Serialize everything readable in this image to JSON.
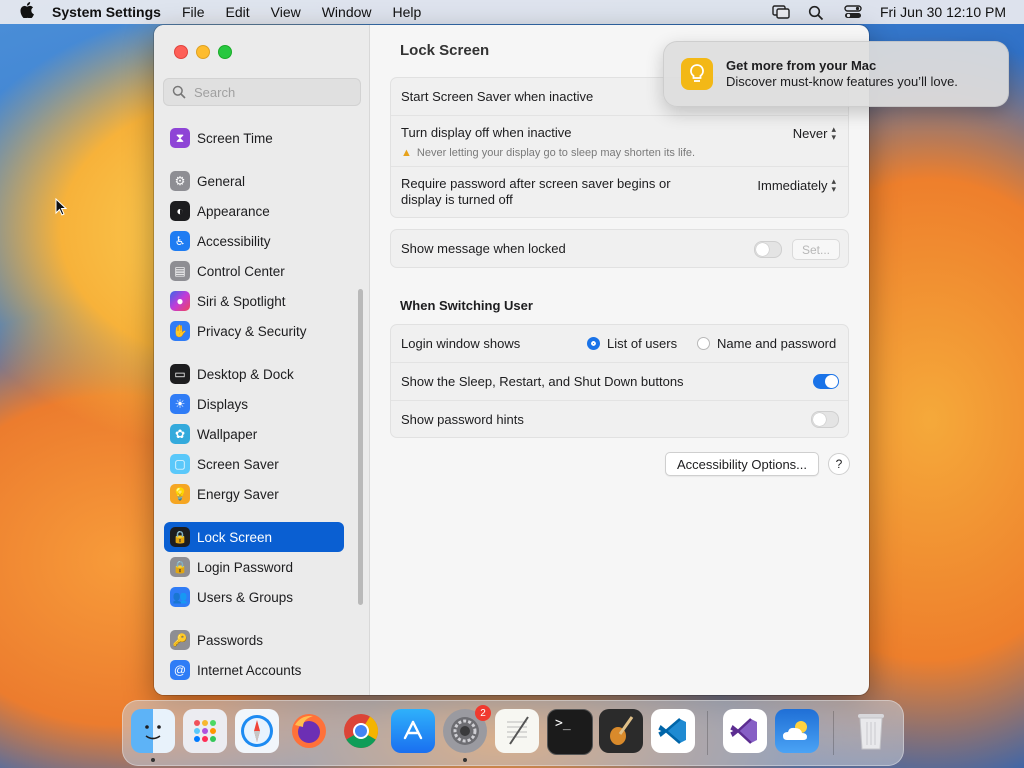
{
  "menubar": {
    "app_name": "System Settings",
    "menus": [
      "File",
      "Edit",
      "View",
      "Window",
      "Help"
    ],
    "clock": "Fri Jun 30  12:10 PM"
  },
  "sidebar": {
    "search_placeholder": "Search",
    "items": [
      {
        "label": "Screen Time",
        "icon": "hourglass-icon",
        "color": "#8e44d6"
      },
      {
        "label": "General",
        "icon": "gear-icon",
        "color": "#8e8e93"
      },
      {
        "label": "Appearance",
        "icon": "appearance-icon",
        "color": "#1d1d1f"
      },
      {
        "label": "Accessibility",
        "icon": "accessibility-icon",
        "color": "#1e7cf2"
      },
      {
        "label": "Control Center",
        "icon": "control-center-icon",
        "color": "#8e8e93"
      },
      {
        "label": "Siri & Spotlight",
        "icon": "siri-icon",
        "color": "#c23bd9"
      },
      {
        "label": "Privacy & Security",
        "icon": "hand-icon",
        "color": "#2f7cf6"
      },
      {
        "label": "Desktop & Dock",
        "icon": "dock-icon",
        "color": "#1d1d1f"
      },
      {
        "label": "Displays",
        "icon": "sun-icon",
        "color": "#2f7cf6"
      },
      {
        "label": "Wallpaper",
        "icon": "flower-icon",
        "color": "#34aadc"
      },
      {
        "label": "Screen Saver",
        "icon": "screen-saver-icon",
        "color": "#5ac8fa"
      },
      {
        "label": "Energy Saver",
        "icon": "lightbulb-icon",
        "color": "#f5a623"
      },
      {
        "label": "Lock Screen",
        "icon": "lock-icon",
        "color": "#1d1d1f"
      },
      {
        "label": "Login Password",
        "icon": "lock-icon",
        "color": "#8e8e93"
      },
      {
        "label": "Users & Groups",
        "icon": "users-icon",
        "color": "#2f7cf6"
      },
      {
        "label": "Passwords",
        "icon": "key-icon",
        "color": "#8e8e93"
      },
      {
        "label": "Internet Accounts",
        "icon": "at-icon",
        "color": "#2f7cf6"
      }
    ],
    "selected": "Lock Screen"
  },
  "content": {
    "title": "Lock Screen",
    "screensaver_label": "Start Screen Saver when inactive",
    "display_off_label": "Turn display off when inactive",
    "display_off_value": "Never",
    "display_off_warning": "Never letting your display go to sleep may shorten its life.",
    "require_password_label": "Require password after screen saver begins or display is turned off",
    "require_password_value": "Immediately",
    "show_message_label": "Show message when locked",
    "show_message_on": false,
    "set_button": "Set...",
    "switching_title": "When Switching User",
    "login_window_label": "Login window shows",
    "login_options": [
      "List of users",
      "Name and password"
    ],
    "login_selected": "List of users",
    "sleep_buttons_label": "Show the Sleep, Restart, and Shut Down buttons",
    "sleep_buttons_on": true,
    "password_hints_label": "Show password hints",
    "password_hints_on": false,
    "accessibility_button": "Accessibility Options...",
    "help_button": "?"
  },
  "notification": {
    "title": "Get more from your Mac",
    "body": "Discover must-know features you’ll love."
  },
  "dock": {
    "apps": [
      {
        "name": "finder-icon",
        "color": "#3c9bf2"
      },
      {
        "name": "launchpad-icon",
        "color": "#e8e8ee"
      },
      {
        "name": "safari-icon",
        "color": "#e9f2fb"
      },
      {
        "name": "firefox-icon",
        "color": "#6c2fb4"
      },
      {
        "name": "chrome-icon",
        "color": "#f2f2f2"
      },
      {
        "name": "app-store-icon",
        "color": "#1e8bf2"
      },
      {
        "name": "system-settings-icon",
        "color": "#8e8e93"
      },
      {
        "name": "textedit-icon",
        "color": "#f6f6f6"
      },
      {
        "name": "terminal-icon",
        "color": "#1b1b1b"
      },
      {
        "name": "instruments-icon",
        "color": "#2a2a2a"
      },
      {
        "name": "vscode-icon",
        "color": "#ffffff"
      },
      {
        "name": "visual-studio-icon",
        "color": "#ffffff"
      },
      {
        "name": "weather-icon",
        "color": "#2f86e8"
      },
      {
        "name": "trash-icon",
        "color": "#e7e7e7"
      }
    ],
    "settings_badge": "2"
  }
}
